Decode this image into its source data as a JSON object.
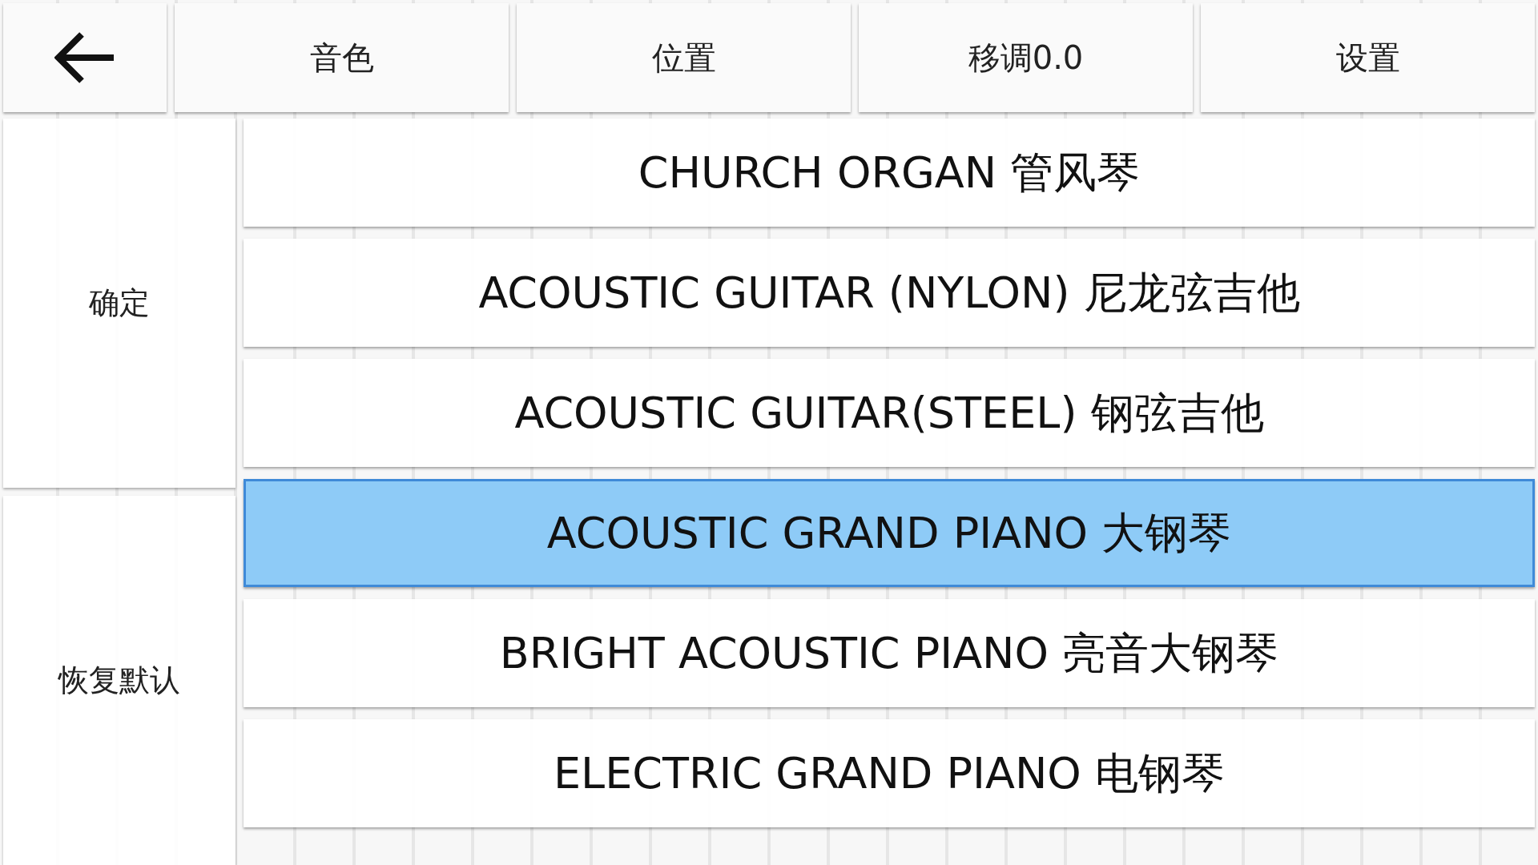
{
  "toolbar": {
    "buttons": [
      {
        "label": "音色"
      },
      {
        "label": "位置"
      },
      {
        "label": "移调0.0"
      },
      {
        "label": "设置"
      }
    ]
  },
  "side_buttons": [
    {
      "label": "确定"
    },
    {
      "label": "恢复默认"
    }
  ],
  "instruments": [
    {
      "label": "CHURCH ORGAN 管风琴",
      "selected": false
    },
    {
      "label": "ACOUSTIC GUITAR (NYLON) 尼龙弦吉他",
      "selected": false
    },
    {
      "label": "ACOUSTIC GUITAR(STEEL) 钢弦吉他",
      "selected": false
    },
    {
      "label": "ACOUSTIC GRAND PIANO 大钢琴",
      "selected": true
    },
    {
      "label": "BRIGHT ACOUSTIC PIANO 亮音大钢琴",
      "selected": false
    },
    {
      "label": "ELECTRIC GRAND PIANO 电钢琴",
      "selected": false
    }
  ]
}
